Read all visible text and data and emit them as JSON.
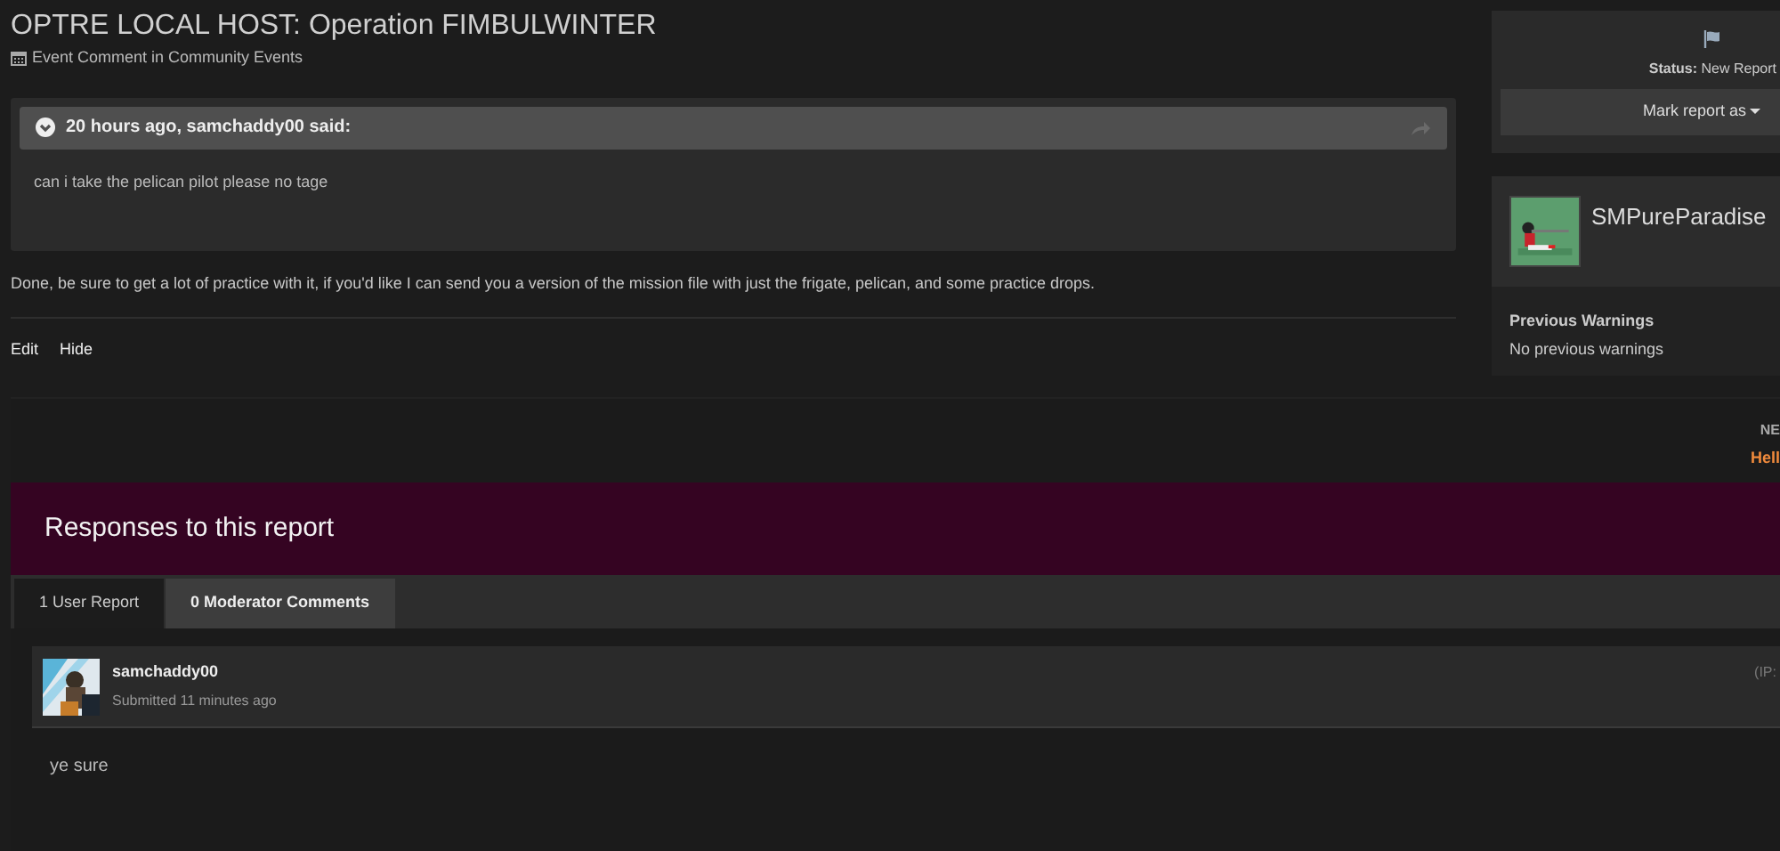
{
  "header": {
    "title": "OPTRE LOCAL HOST: Operation FIMBULWINTER",
    "subtitle": "Event Comment in Community Events"
  },
  "quote": {
    "author_line": "20 hours ago, samchaddy00 said:",
    "text": "can i take the pelican pilot please no tage"
  },
  "comment": "Done, be sure to get a lot of practice with it, if you'd like I can send you a version of the mission file with just the frigate, pelican, and some practice drops.",
  "actions": [
    "Edit",
    "Hide"
  ],
  "status_card": {
    "status_label": "Status:",
    "status_value": "New Report",
    "button": "Mark report as"
  },
  "user_card": {
    "name": "SMPureParadise",
    "warnings_title": "Previous Warnings",
    "warnings_text": "No previous warnings"
  },
  "notice": {
    "label": "NE",
    "link": "Hell"
  },
  "responses": {
    "title": "Responses to this report",
    "tabs": [
      {
        "label": "1 User Report",
        "selected": true
      },
      {
        "label": "0 Moderator Comments",
        "selected": false
      }
    ],
    "reports": [
      {
        "author": "samchaddy00",
        "time": "Submitted 11 minutes ago",
        "ip": "(IP:",
        "text": "ye sure"
      }
    ]
  }
}
